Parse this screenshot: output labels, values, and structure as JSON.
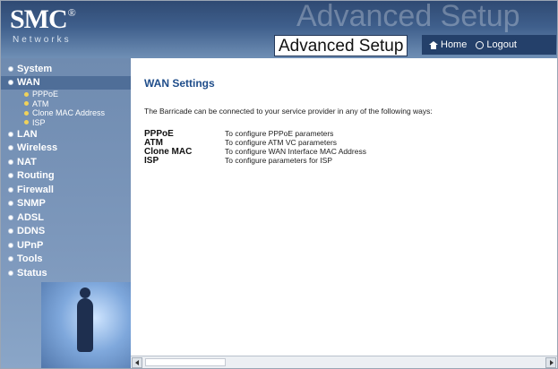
{
  "header": {
    "logo": "SMC",
    "logo_mark": "®",
    "logo_sub": "Networks",
    "watermark": "Advanced Setup",
    "title": "Advanced Setup",
    "home_label": "Home",
    "logout_label": "Logout"
  },
  "sidebar": {
    "items": [
      {
        "label": "System"
      },
      {
        "label": "WAN"
      },
      {
        "label": "LAN"
      },
      {
        "label": "Wireless"
      },
      {
        "label": "NAT"
      },
      {
        "label": "Routing"
      },
      {
        "label": "Firewall"
      },
      {
        "label": "SNMP"
      },
      {
        "label": "ADSL"
      },
      {
        "label": "DDNS"
      },
      {
        "label": "UPnP"
      },
      {
        "label": "Tools"
      },
      {
        "label": "Status"
      }
    ],
    "wan_subitems": [
      {
        "label": "PPPoE"
      },
      {
        "label": "ATM"
      },
      {
        "label": "Clone MAC Address"
      },
      {
        "label": "ISP"
      }
    ]
  },
  "main": {
    "title": "WAN Settings",
    "intro": "The Barricade can be connected to your service provider in any of the following ways:",
    "options": [
      {
        "name": "PPPoE",
        "desc": "To configure PPPoE parameters"
      },
      {
        "name": "ATM",
        "desc": "To configure ATM VC parameters"
      },
      {
        "name": "Clone MAC",
        "desc": "To configure WAN Interface MAC Address"
      },
      {
        "name": "ISP",
        "desc": "To configure parameters for ISP"
      }
    ]
  },
  "colors": {
    "header_bg": "#3f5f8c",
    "sidebar_bg": "#7d98bc",
    "title_color": "#1f4d8a",
    "sub_bullet": "#f0d25a"
  }
}
